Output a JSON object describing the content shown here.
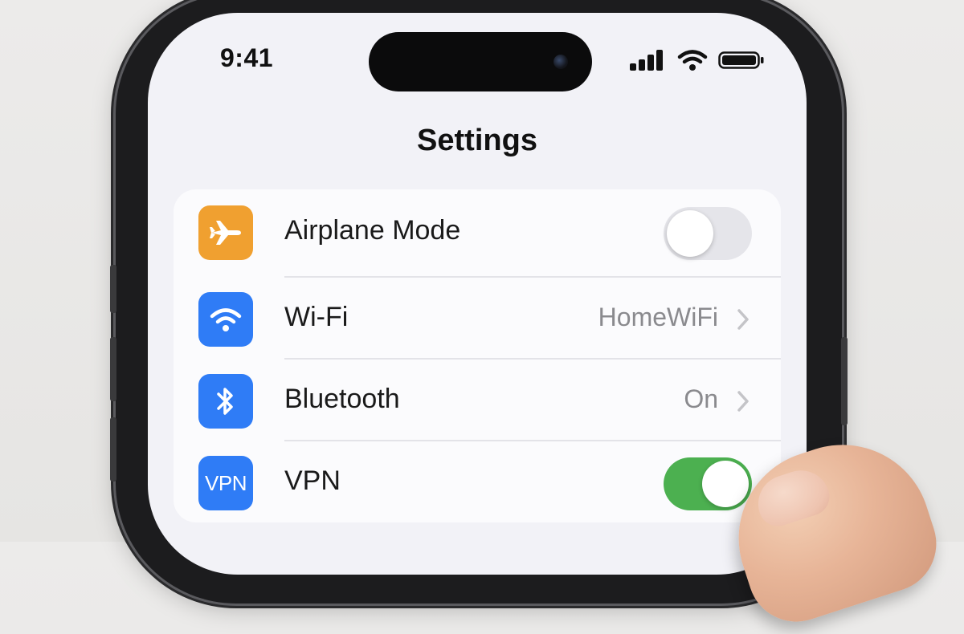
{
  "status_bar": {
    "time": "9:41",
    "icons": [
      "signal-icon",
      "wifi-icon",
      "battery-icon"
    ]
  },
  "header": {
    "title": "Settings"
  },
  "settings": {
    "rows": [
      {
        "label": "Airplane Mode",
        "icon": "airplane-icon",
        "icon_color": "#f0a030",
        "control": "toggle",
        "toggle_state": "off"
      },
      {
        "label": "Wi-Fi",
        "icon": "wifi-icon",
        "icon_color": "#2f7cf6",
        "control": "disclosure",
        "value": "HomeWiFi"
      },
      {
        "label": "Bluetooth",
        "icon": "bluetooth-icon",
        "icon_color": "#2f7cf6",
        "control": "disclosure",
        "value": "On"
      },
      {
        "label": "VPN",
        "icon": "vpn-icon",
        "icon_text": "VPN",
        "icon_color": "#2f7cf6",
        "control": "toggle",
        "toggle_state": "on"
      }
    ]
  },
  "colors": {
    "toggle_on": "#4cb050",
    "toggle_off": "#e5e5ea",
    "accent_blue": "#2f7cf6",
    "accent_orange": "#f0a030"
  }
}
